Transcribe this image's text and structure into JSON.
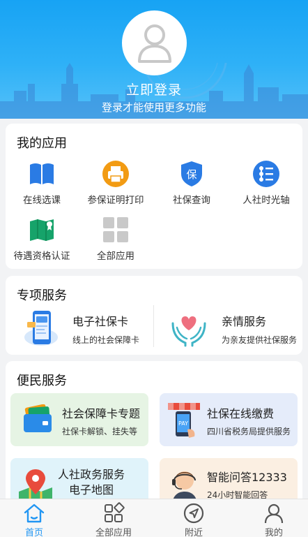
{
  "header": {
    "login_title": "立即登录",
    "login_subtitle": "登录才能使用更多功能"
  },
  "my_apps": {
    "title": "我的应用",
    "items": [
      {
        "label": "在线选课",
        "icon": "book-icon"
      },
      {
        "label": "参保证明打印",
        "icon": "printer-icon"
      },
      {
        "label": "社保查询",
        "icon": "shield-icon"
      },
      {
        "label": "人社时光轴",
        "icon": "timeline-icon"
      },
      {
        "label": "待遇资格认证",
        "icon": "certify-map-icon"
      },
      {
        "label": "全部应用",
        "icon": "grid-icon"
      }
    ]
  },
  "special_services": {
    "title": "专项服务",
    "items": [
      {
        "title": "电子社保卡",
        "subtitle": "线上的社会保障卡",
        "icon": "phone-card-icon"
      },
      {
        "title": "亲情服务",
        "subtitle": "为亲友提供社保服务",
        "icon": "heart-hands-icon"
      }
    ]
  },
  "convenience_services": {
    "title": "便民服务",
    "items": [
      {
        "title": "社会保障卡专题",
        "subtitle": "社保卡解锁、挂失等",
        "icon": "wallet-card-icon",
        "bg": "#e6f4e4"
      },
      {
        "title": "社保在线缴费",
        "subtitle": "四川省税务局提供服务",
        "icon": "pay-store-icon",
        "bg": "#e5ecfa"
      },
      {
        "title": "人社政务服务",
        "title2": "电子地图",
        "icon": "map-pin-icon",
        "bg": "#e0f3fa"
      },
      {
        "title": "智能问答12333",
        "subtitle": "24小时智能回答",
        "icon": "headset-agent-icon",
        "bg": "#fbefe2"
      }
    ]
  },
  "bottom_nav": {
    "items": [
      {
        "label": "首页",
        "icon": "home-icon",
        "active": true
      },
      {
        "label": "全部应用",
        "icon": "apps-icon",
        "active": false
      },
      {
        "label": "附近",
        "icon": "compass-icon",
        "active": false
      },
      {
        "label": "我的",
        "icon": "user-icon",
        "active": false
      }
    ]
  },
  "colors": {
    "header_top": "#17a3f4",
    "accent": "#2196f3",
    "page_bg": "#f2f3f5"
  }
}
